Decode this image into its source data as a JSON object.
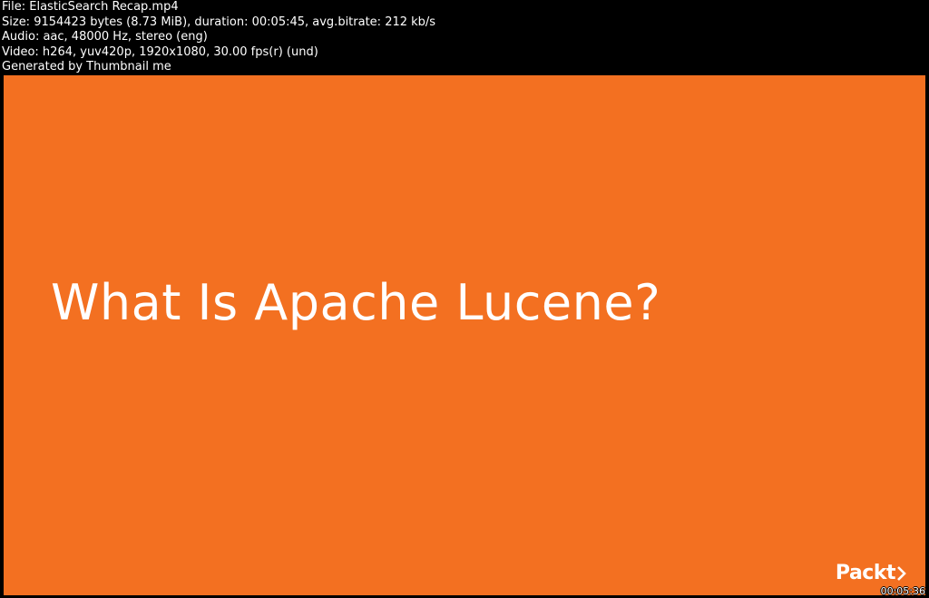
{
  "header": {
    "file": "File: ElasticSearch Recap.mp4",
    "size": "Size: 9154423 bytes (8.73 MiB), duration: 00:05:45, avg.bitrate: 212 kb/s",
    "audio": "Audio: aac, 48000 Hz, stereo (eng)",
    "video": "Video: h264, yuv420p, 1920x1080, 30.00 fps(r) (und)",
    "generator": "Generated by Thumbnail me"
  },
  "slide": {
    "title": "What Is Apache Lucene?",
    "background_color": "#f37021",
    "logo": "Packt"
  },
  "timestamp": "00:05:36"
}
